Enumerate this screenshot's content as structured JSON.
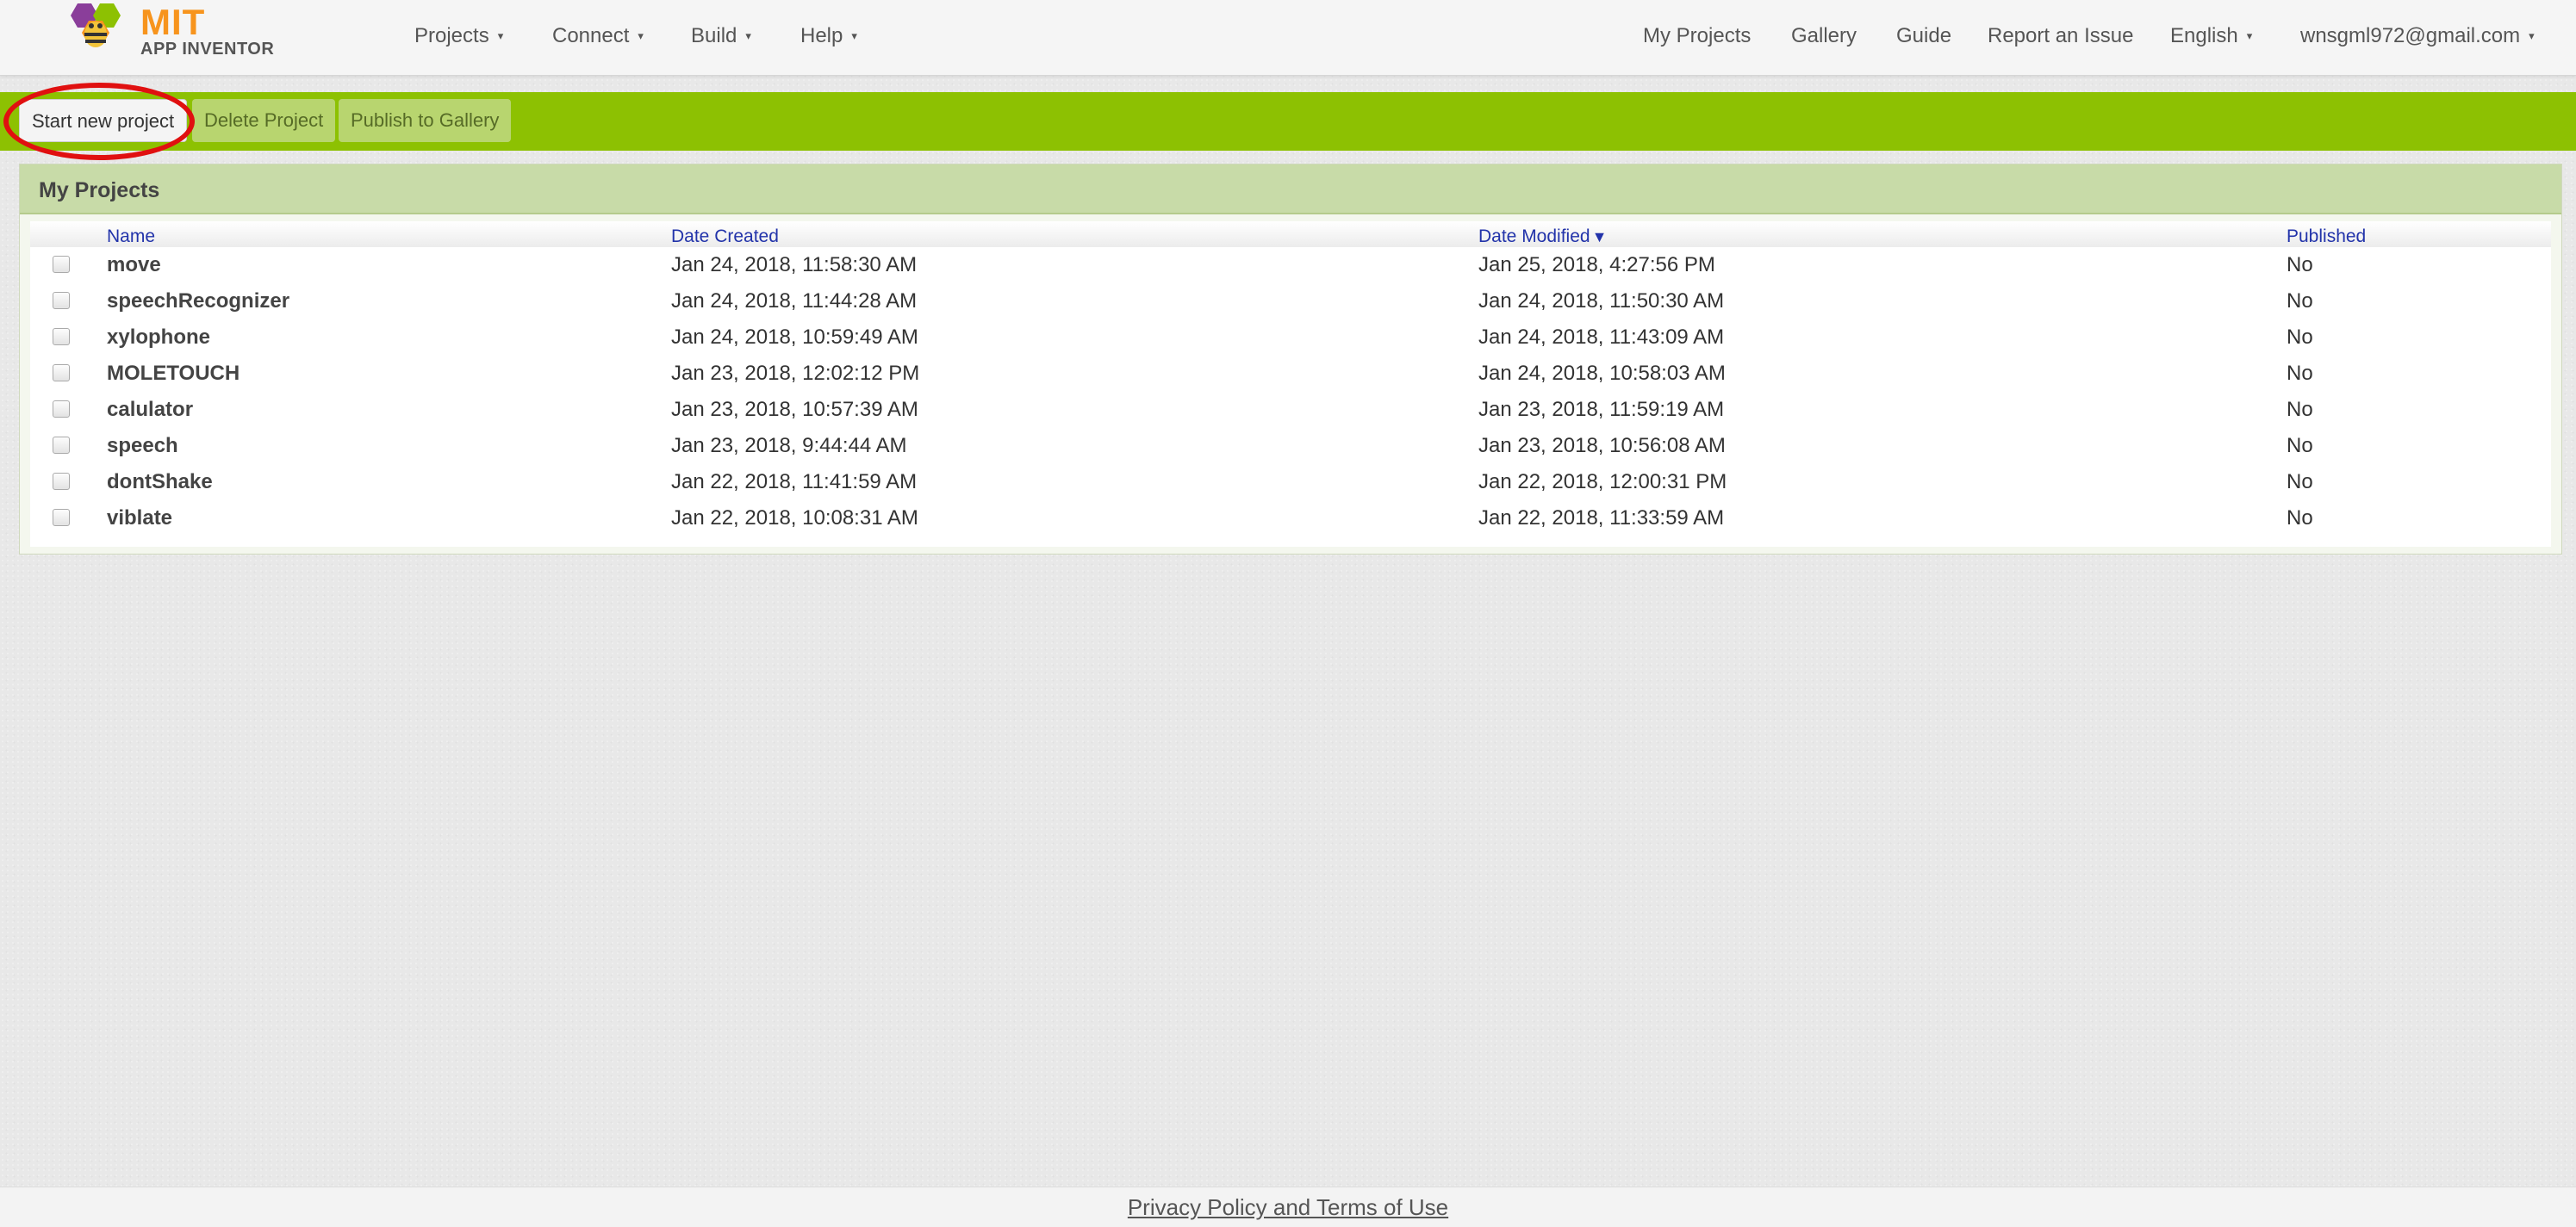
{
  "brand": {
    "mit": "MIT",
    "subtitle": "APP INVENTOR",
    "colors": {
      "orange": "#f7941d",
      "purple": "#8a3e9a",
      "green": "#8dc102"
    }
  },
  "nav_left": [
    {
      "label": "Projects",
      "caret": "▾"
    },
    {
      "label": "Connect",
      "caret": "▾"
    },
    {
      "label": "Build",
      "caret": "▾"
    },
    {
      "label": "Help",
      "caret": "▾"
    }
  ],
  "nav_right": {
    "my_projects": "My Projects",
    "gallery": "Gallery",
    "guide": "Guide",
    "report": "Report an Issue",
    "language": "English",
    "language_caret": "▾",
    "account": "wnsgml972@gmail.com",
    "account_caret": "▾"
  },
  "toolbar": {
    "start_new": "Start new project",
    "delete": "Delete Project",
    "publish": "Publish to Gallery"
  },
  "panel": {
    "title": "My Projects"
  },
  "table": {
    "headers": {
      "name": "Name",
      "created": "Date Created",
      "modified": "Date Modified",
      "sort_indicator": "▼",
      "published": "Published"
    },
    "rows": [
      {
        "name": "move",
        "created": "Jan 24, 2018, 11:58:30 AM",
        "modified": "Jan 25, 2018, 4:27:56 PM",
        "published": "No"
      },
      {
        "name": "speechRecognizer",
        "created": "Jan 24, 2018, 11:44:28 AM",
        "modified": "Jan 24, 2018, 11:50:30 AM",
        "published": "No"
      },
      {
        "name": "xylophone",
        "created": "Jan 24, 2018, 10:59:49 AM",
        "modified": "Jan 24, 2018, 11:43:09 AM",
        "published": "No"
      },
      {
        "name": "MOLETOUCH",
        "created": "Jan 23, 2018, 12:02:12 PM",
        "modified": "Jan 24, 2018, 10:58:03 AM",
        "published": "No"
      },
      {
        "name": "calulator",
        "created": "Jan 23, 2018, 10:57:39 AM",
        "modified": "Jan 23, 2018, 11:59:19 AM",
        "published": "No"
      },
      {
        "name": "speech",
        "created": "Jan 23, 2018, 9:44:44 AM",
        "modified": "Jan 23, 2018, 10:56:08 AM",
        "published": "No"
      },
      {
        "name": "dontShake",
        "created": "Jan 22, 2018, 11:41:59 AM",
        "modified": "Jan 22, 2018, 12:00:31 PM",
        "published": "No"
      },
      {
        "name": "viblate",
        "created": "Jan 22, 2018, 10:08:31 AM",
        "modified": "Jan 22, 2018, 11:33:59 AM",
        "published": "No"
      }
    ]
  },
  "footer": {
    "link": "Privacy Policy and Terms of Use"
  }
}
